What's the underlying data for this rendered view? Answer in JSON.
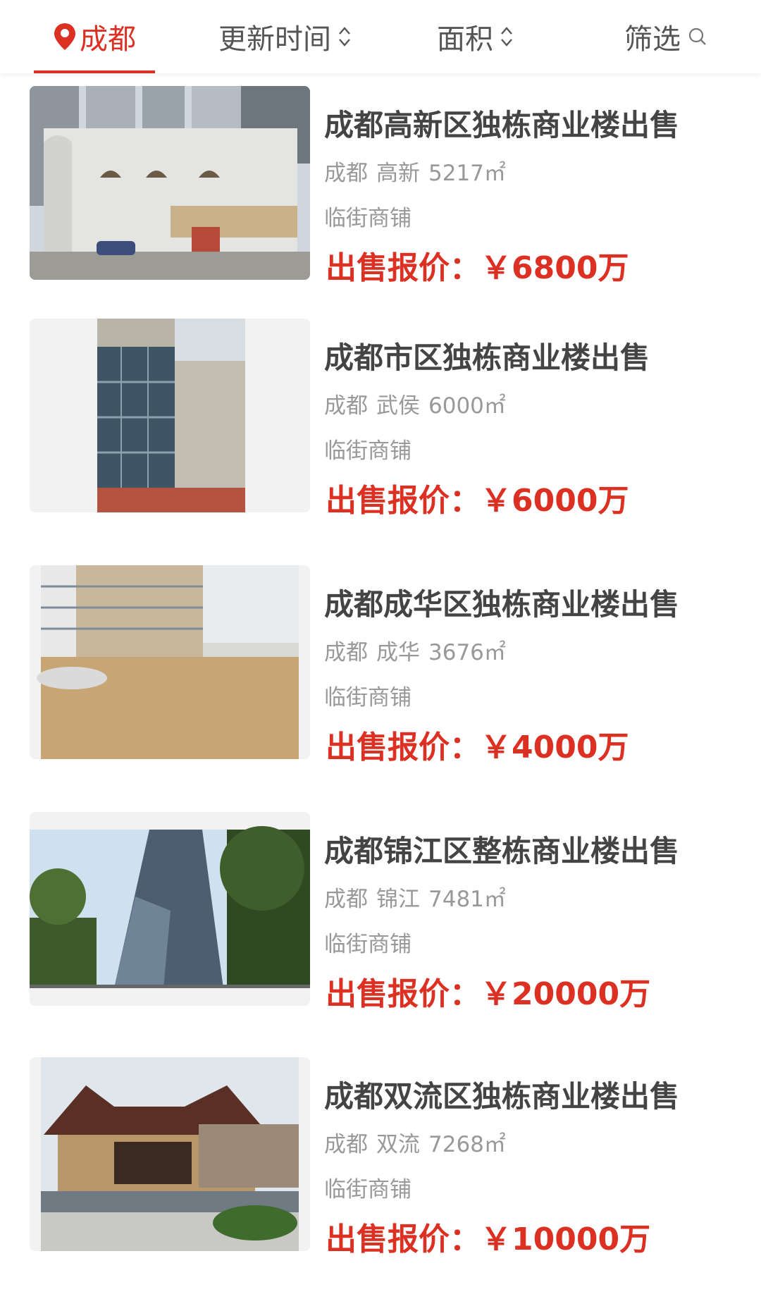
{
  "header": {
    "city_tab": "成都",
    "time_tab": "更新时间",
    "area_tab": "面积",
    "filter_tab": "筛选"
  },
  "colors": {
    "accent": "#dc3023",
    "title_text": "#444444",
    "secondary_text": "#999999"
  },
  "listings": [
    {
      "title": "成都高新区独栋商业楼出售",
      "city": "成都",
      "district": "高新",
      "area": "5217㎡",
      "tag": "临街商铺",
      "price_label": "出售报价：",
      "price": "￥6800万"
    },
    {
      "title": "成都市区独栋商业楼出售",
      "city": "成都",
      "district": "武侯",
      "area": "6000㎡",
      "tag": "临街商铺",
      "price_label": "出售报价：",
      "price": "￥6000万"
    },
    {
      "title": "成都成华区独栋商业楼出售",
      "city": "成都",
      "district": "成华",
      "area": "3676㎡",
      "tag": "临街商铺",
      "price_label": "出售报价：",
      "price": "￥4000万"
    },
    {
      "title": "成都锦江区整栋商业楼出售",
      "city": "成都",
      "district": "锦江",
      "area": "7481㎡",
      "tag": "临街商铺",
      "price_label": "出售报价：",
      "price": "￥20000万"
    },
    {
      "title": "成都双流区独栋商业楼出售",
      "city": "成都",
      "district": "双流",
      "area": "7268㎡",
      "tag": "临街商铺",
      "price_label": "出售报价：",
      "price": "￥10000万"
    }
  ]
}
